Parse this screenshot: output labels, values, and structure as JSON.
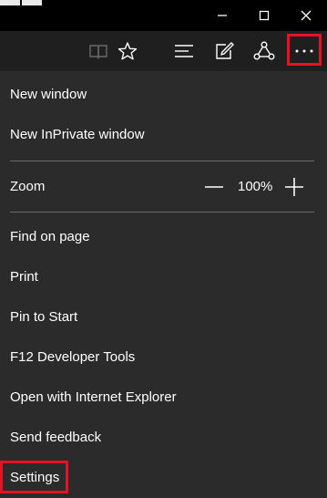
{
  "menu": {
    "new_window": "New window",
    "new_inprivate": "New InPrivate window",
    "zoom_label": "Zoom",
    "zoom_value": "100%",
    "find_on_page": "Find on page",
    "print": "Print",
    "pin_to_start": "Pin to Start",
    "dev_tools": "F12 Developer Tools",
    "open_with_ie": "Open with Internet Explorer",
    "send_feedback": "Send feedback",
    "settings": "Settings"
  },
  "icons": {
    "minimize": "minimize-icon",
    "maximize": "maximize-icon",
    "close": "close-icon",
    "reading_view": "reading-view-icon",
    "favorite": "star-icon",
    "hub": "hub-icon",
    "web_note": "web-note-icon",
    "share": "share-icon",
    "more": "more-icon"
  },
  "colors": {
    "highlight": "#e81123",
    "menu_bg": "#2b2b2b",
    "toolbar_bg": "#1f1f1f",
    "titlebar_bg": "#000000"
  }
}
